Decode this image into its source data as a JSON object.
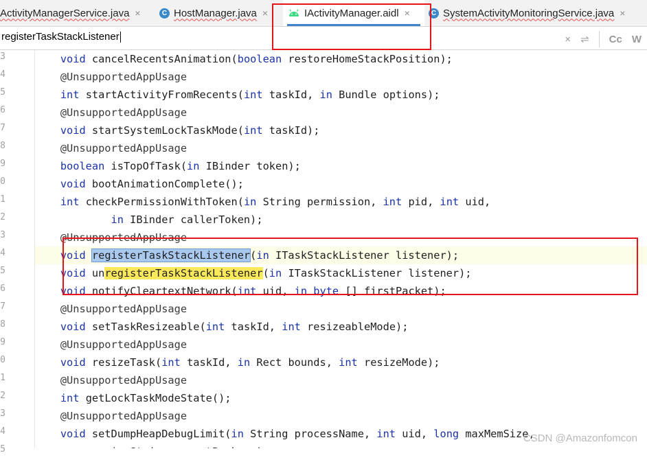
{
  "tabs": [
    {
      "label": "ActivityManagerService.java",
      "close": "×",
      "icon": "java-class-icon"
    },
    {
      "label": "HostManager.java",
      "close": "×",
      "icon": "java-class-icon",
      "icon_letter": "C"
    },
    {
      "label": "IActivityManager.aidl",
      "close": "×",
      "icon": "android-icon",
      "active": true
    },
    {
      "label": "SystemActivityMonitoringService.java",
      "close": "×",
      "icon": "java-class-icon",
      "icon_letter": "C"
    }
  ],
  "tab_overflow": "⌄",
  "search": {
    "value": "registerTaskStackListener",
    "clear": "×",
    "replace": "⇌",
    "match_case": "Cc",
    "words": "W"
  },
  "gutter_digits": [
    "3",
    "4",
    "5",
    "6",
    "7",
    "8",
    "9",
    "0",
    "1",
    "2",
    "3",
    "4",
    "5",
    "6",
    "7",
    "8",
    "9",
    "0",
    "1",
    "2",
    "3",
    "4",
    "5"
  ],
  "code_lines": [
    {
      "indent": "    ",
      "tokens": [
        [
          "kw",
          "void"
        ],
        [
          "",
          "cancelRecentsAnimation("
        ],
        [
          "kw",
          "boolean"
        ],
        [
          "",
          "restoreHomeStackPosition);"
        ]
      ]
    },
    {
      "indent": "    ",
      "tokens": [
        [
          "ann",
          "@UnsupportedAppUsage"
        ]
      ]
    },
    {
      "indent": "    ",
      "tokens": [
        [
          "kw",
          "int"
        ],
        [
          "",
          "startActivityFromRecents("
        ],
        [
          "kw",
          "int"
        ],
        [
          "",
          "taskId, "
        ],
        [
          "kw",
          "in"
        ],
        [
          "",
          "Bundle options);"
        ]
      ]
    },
    {
      "indent": "    ",
      "tokens": [
        [
          "ann",
          "@UnsupportedAppUsage"
        ]
      ]
    },
    {
      "indent": "    ",
      "tokens": [
        [
          "kw",
          "void"
        ],
        [
          "",
          "startSystemLockTaskMode("
        ],
        [
          "kw",
          "int"
        ],
        [
          "",
          "taskId);"
        ]
      ]
    },
    {
      "indent": "    ",
      "tokens": [
        [
          "ann",
          "@UnsupportedAppUsage"
        ]
      ]
    },
    {
      "indent": "    ",
      "tokens": [
        [
          "kw",
          "boolean"
        ],
        [
          "",
          "isTopOfTask("
        ],
        [
          "kw",
          "in"
        ],
        [
          "",
          "IBinder token);"
        ]
      ]
    },
    {
      "indent": "    ",
      "tokens": [
        [
          "kw",
          "void"
        ],
        [
          "",
          "bootAnimationComplete();"
        ]
      ]
    },
    {
      "indent": "    ",
      "tokens": [
        [
          "kw",
          "int"
        ],
        [
          "",
          "checkPermissionWithToken("
        ],
        [
          "kw",
          "in"
        ],
        [
          "",
          "String permission, "
        ],
        [
          "kw",
          "int"
        ],
        [
          "",
          "pid, "
        ],
        [
          "kw",
          "int"
        ],
        [
          "",
          "uid,"
        ]
      ]
    },
    {
      "indent": "            ",
      "tokens": [
        [
          "kw",
          "in"
        ],
        [
          "",
          "IBinder callerToken);"
        ]
      ]
    },
    {
      "indent": "    ",
      "tokens": [
        [
          "ann",
          "@UnsupportedAppUsage"
        ]
      ]
    },
    {
      "indent": "    ",
      "caret": true,
      "tokens": [
        [
          "kw",
          "void"
        ],
        [
          "hl1",
          "registerTaskStackListener"
        ],
        [
          "",
          "("
        ],
        [
          "kw",
          "in"
        ],
        [
          "",
          "ITaskStackListener listener);"
        ]
      ]
    },
    {
      "indent": "    ",
      "tokens": [
        [
          "kw",
          "void"
        ],
        [
          "",
          "un"
        ],
        [
          "hl2",
          "registerTaskStackListener"
        ],
        [
          "",
          "("
        ],
        [
          "kw",
          "in"
        ],
        [
          "",
          "ITaskStackListener listener);"
        ]
      ]
    },
    {
      "indent": "    ",
      "tokens": [
        [
          "kw",
          "void"
        ],
        [
          "",
          "notifyCleartextNetwork("
        ],
        [
          "kw",
          "int"
        ],
        [
          "",
          "uid, "
        ],
        [
          "kw",
          "in"
        ],
        [
          "kw",
          "byte"
        ],
        [
          "",
          "[] firstPacket);"
        ]
      ]
    },
    {
      "indent": "    ",
      "tokens": [
        [
          "ann",
          "@UnsupportedAppUsage"
        ]
      ]
    },
    {
      "indent": "    ",
      "tokens": [
        [
          "kw",
          "void"
        ],
        [
          "",
          "setTaskResizeable("
        ],
        [
          "kw",
          "int"
        ],
        [
          "",
          "taskId, "
        ],
        [
          "kw",
          "int"
        ],
        [
          "",
          "resizeableMode);"
        ]
      ]
    },
    {
      "indent": "    ",
      "tokens": [
        [
          "ann",
          "@UnsupportedAppUsage"
        ]
      ]
    },
    {
      "indent": "    ",
      "tokens": [
        [
          "kw",
          "void"
        ],
        [
          "",
          "resizeTask("
        ],
        [
          "kw",
          "int"
        ],
        [
          "",
          "taskId, "
        ],
        [
          "kw",
          "in"
        ],
        [
          "",
          "Rect bounds, "
        ],
        [
          "kw",
          "int"
        ],
        [
          "",
          "resizeMode);"
        ]
      ]
    },
    {
      "indent": "    ",
      "tokens": [
        [
          "ann",
          "@UnsupportedAppUsage"
        ]
      ]
    },
    {
      "indent": "    ",
      "tokens": [
        [
          "kw",
          "int"
        ],
        [
          "",
          "getLockTaskModeState();"
        ]
      ]
    },
    {
      "indent": "    ",
      "tokens": [
        [
          "ann",
          "@UnsupportedAppUsage"
        ]
      ]
    },
    {
      "indent": "    ",
      "tokens": [
        [
          "kw",
          "void"
        ],
        [
          "",
          "setDumpHeapDebugLimit("
        ],
        [
          "kw",
          "in"
        ],
        [
          "",
          "String processName, "
        ],
        [
          "kw",
          "int"
        ],
        [
          "",
          "uid, "
        ],
        [
          "kw",
          "long"
        ],
        [
          "",
          "maxMemSize,"
        ]
      ]
    },
    {
      "indent": "            ",
      "tokens": [
        [
          "kw",
          "in"
        ],
        [
          "",
          "String reportPackage);"
        ]
      ]
    }
  ],
  "watermark": "CSDN @Amazonfomcon"
}
